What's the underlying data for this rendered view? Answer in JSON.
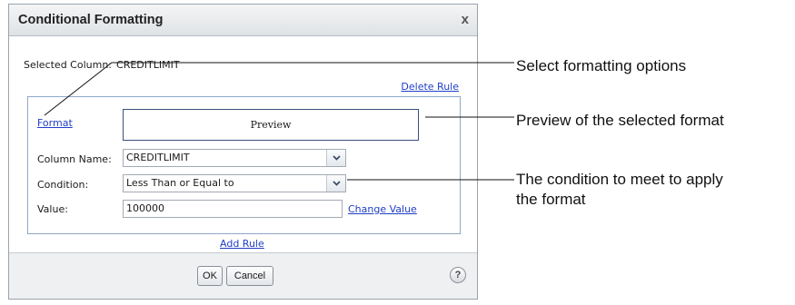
{
  "dialog": {
    "title": "Conditional Formatting",
    "close_label": "x",
    "selected_column_label": "Selected Column:",
    "selected_column_value": "CREDITLIMIT",
    "delete_rule": "Delete Rule",
    "format_link": "Format",
    "preview": "Preview",
    "column_name_label": "Column Name:",
    "column_name_value": "CREDITLIMIT",
    "condition_label": "Condition:",
    "condition_value": "Less Than or Equal to",
    "value_label": "Value:",
    "value_value": "100000",
    "change_value": "Change Value",
    "add_rule": "Add Rule",
    "ok": "OK",
    "cancel": "Cancel",
    "help": "?"
  },
  "callouts": {
    "formatting_options": "Select formatting options",
    "preview_format": "Preview of the selected format",
    "condition_line1": "The condition to meet to apply",
    "condition_line2": "the format"
  },
  "icons": {
    "dropdown": "chevron-down-icon",
    "help": "help-icon",
    "close": "close-icon"
  }
}
